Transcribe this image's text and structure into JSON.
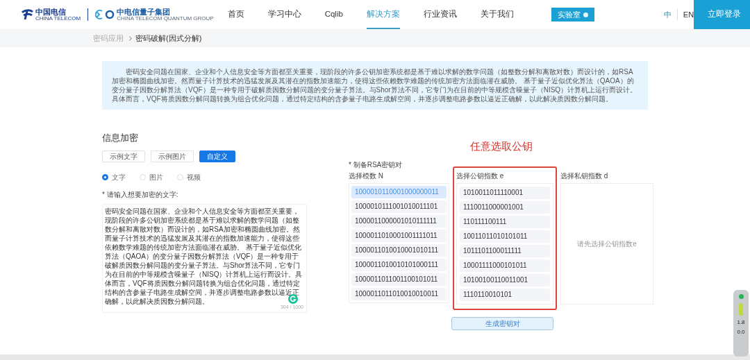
{
  "header": {
    "logo_text": "中国电信",
    "logo_subtext": "CHINA TELECOM",
    "group_text": "中电信量子集团",
    "group_subtext": "CHINA TELECOM QUANTUM GROUP",
    "nav": [
      {
        "label": "首页",
        "selected": false
      },
      {
        "label": "学习中心",
        "selected": false
      },
      {
        "label": "Cqlib",
        "selected": false
      },
      {
        "label": "解决方案",
        "selected": true
      },
      {
        "label": "行业资讯",
        "selected": false
      },
      {
        "label": "关于我们",
        "selected": false
      }
    ],
    "lab_button": "实验室",
    "languages": [
      {
        "label": "中",
        "selected": true
      },
      {
        "label": "EN",
        "selected": false
      }
    ],
    "login_button": "立即登录"
  },
  "breadcrumb": [
    "密码应用",
    "密码破解(因式分解)"
  ],
  "intro": "密码安全问题在国家、企业和个人信息安全等方面都至关重要，现阶段的许多公钥加密系统都是基于难以求解的数学问题（如整数分解和离散对数）而设计的，如RSA加密和椭圆曲线加密。然而量子计算技术的迅猛发展及其潜在的指数加速能力，使得这些依赖数学难题的传统加密方法面临潜在威胁。 基于量子近似优化算法（QAOA）的变分量子因数分解算法（VQF）是一种专用于破解质因数分解问题的变分量子算法。与Shor算法不同，它专门为在目前的中等规模含噪量子（NISQ）计算机上运行而设计。具体而言，VQF将质因数分解问题转换为组合优化问题，通过特定结构的含参量子电路生成解空间，并逐步调整电路参数以逼近正确解，以此解决质因数分解问题。",
  "encrypt": {
    "title": "信息加密",
    "mode_buttons": [
      {
        "label": "示例文字",
        "selected": false
      },
      {
        "label": "示例图片",
        "selected": false
      },
      {
        "label": "自定义",
        "selected": true
      }
    ],
    "types": [
      {
        "label": "文字",
        "selected": true
      },
      {
        "label": "图片",
        "selected": false
      },
      {
        "label": "视频",
        "selected": false
      }
    ],
    "input_label": "* 请输入想要加密的文字:",
    "input_value": "密码安全问题在国家、企业和个人信息安全等方面都至关重要，现阶段的许多公钥加密系统都是基于难以求解的数学问题（如整数分解和离散对数）而设计的，如RSA加密和椭圆曲线加密。然而量子计算技术的迅猛发展及其潜在的指数加速能力，使得这些依赖数学难题的传统加密方法面临潜在威胁。 基于量子近似优化算法（QAOA）的变分量子因数分解算法（VQF）是一种专用于破解质因数分解问题的变分量子算法。与Shor算法不同，它专门为在目前的中等规模含噪量子（NISQ）计算机上运行而设计。具体而言，VQF将质因数分解问题转换为组合优化问题，通过特定结构的含参量子电路生成解空间，并逐步调整电路参数以逼近正确解，以此解决质因数分解问题。",
    "counter": "304 / 1000"
  },
  "annotation": "任意选取公钥",
  "keypair": {
    "label": "* 制备RSA密钥对",
    "modulus": {
      "title": "选择模数 N",
      "items": [
        {
          "value": "1000010110001000000011",
          "selected": true
        },
        {
          "value": "1000010111001010011101",
          "selected": false
        },
        {
          "value": "1000011000001010111111",
          "selected": false
        },
        {
          "value": "1000011010001001111011",
          "selected": false
        },
        {
          "value": "1000011010010001010111",
          "selected": false
        },
        {
          "value": "1000011010010101000111",
          "selected": false
        },
        {
          "value": "1000011011001100101011",
          "selected": false
        },
        {
          "value": "1000011011010010010011",
          "selected": false
        }
      ]
    },
    "public": {
      "title": "选择公钥指数 e",
      "items": [
        {
          "value": "1010011011110001",
          "selected": false
        },
        {
          "value": "1110011000001001",
          "selected": false
        },
        {
          "value": "110111100111",
          "selected": false
        },
        {
          "value": "10011011010101011",
          "selected": false
        },
        {
          "value": "1011101100011111",
          "selected": false
        },
        {
          "value": "10001111000101011",
          "selected": false
        },
        {
          "value": "10100100110011001",
          "selected": false
        },
        {
          "value": "1110110010101",
          "selected": false
        }
      ]
    },
    "private": {
      "title": "选择私钥指数 d",
      "placeholder": "请先选择公钥指数e"
    },
    "generate_button": "生成密钥对"
  },
  "monitor": {
    "readings": [
      "1.8",
      "0.0"
    ]
  }
}
